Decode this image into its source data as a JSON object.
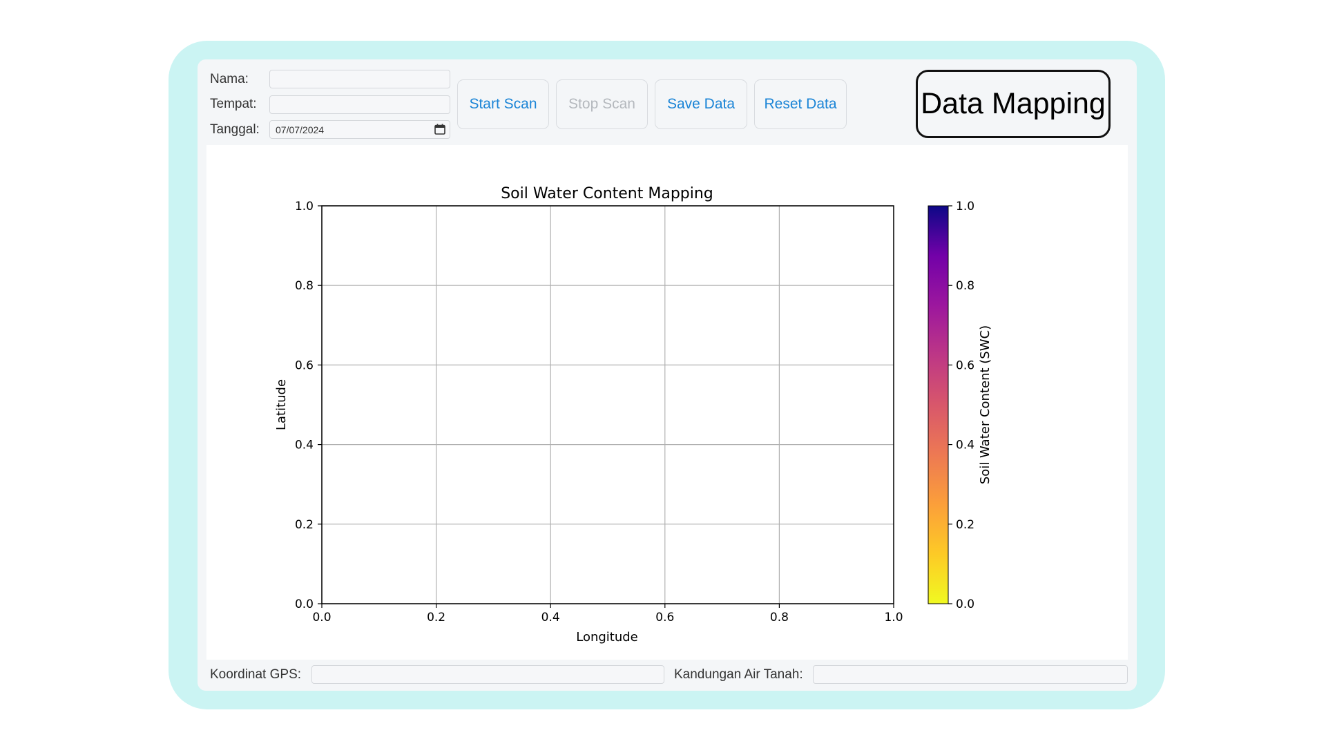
{
  "form": {
    "nama_label": "Nama:",
    "nama_value": "",
    "tempat_label": "Tempat:",
    "tempat_value": "",
    "tanggal_label": "Tanggal:",
    "tanggal_value": "07/07/2024"
  },
  "toolbar": {
    "start_label": "Start Scan",
    "stop_label": "Stop Scan",
    "save_label": "Save Data",
    "reset_label": "Reset Data"
  },
  "app_title": "Data Mapping",
  "footer": {
    "gps_label": "Koordinat GPS:",
    "gps_value": "",
    "swc_label": "Kandungan Air Tanah:",
    "swc_value": ""
  },
  "colors": {
    "frame": "#cbf4f3",
    "accent": "#1a84d6",
    "disabled": "#b4b8bd"
  },
  "chart_data": {
    "type": "scatter",
    "title": "Soil Water Content Mapping",
    "xlabel": "Longitude",
    "ylabel": "Latitude",
    "xlim": [
      0.0,
      1.0
    ],
    "ylim": [
      0.0,
      1.0
    ],
    "xticks": [
      "0.0",
      "0.2",
      "0.4",
      "0.6",
      "0.8",
      "1.0"
    ],
    "yticks": [
      "0.0",
      "0.2",
      "0.4",
      "0.6",
      "0.8",
      "1.0"
    ],
    "grid": true,
    "points": [],
    "colorbar": {
      "label": "Soil Water Content (SWC)",
      "colormap": "plasma_r",
      "range": [
        0.0,
        1.0
      ],
      "ticks": [
        "0.0",
        "0.2",
        "0.4",
        "0.6",
        "0.8",
        "1.0"
      ]
    }
  }
}
